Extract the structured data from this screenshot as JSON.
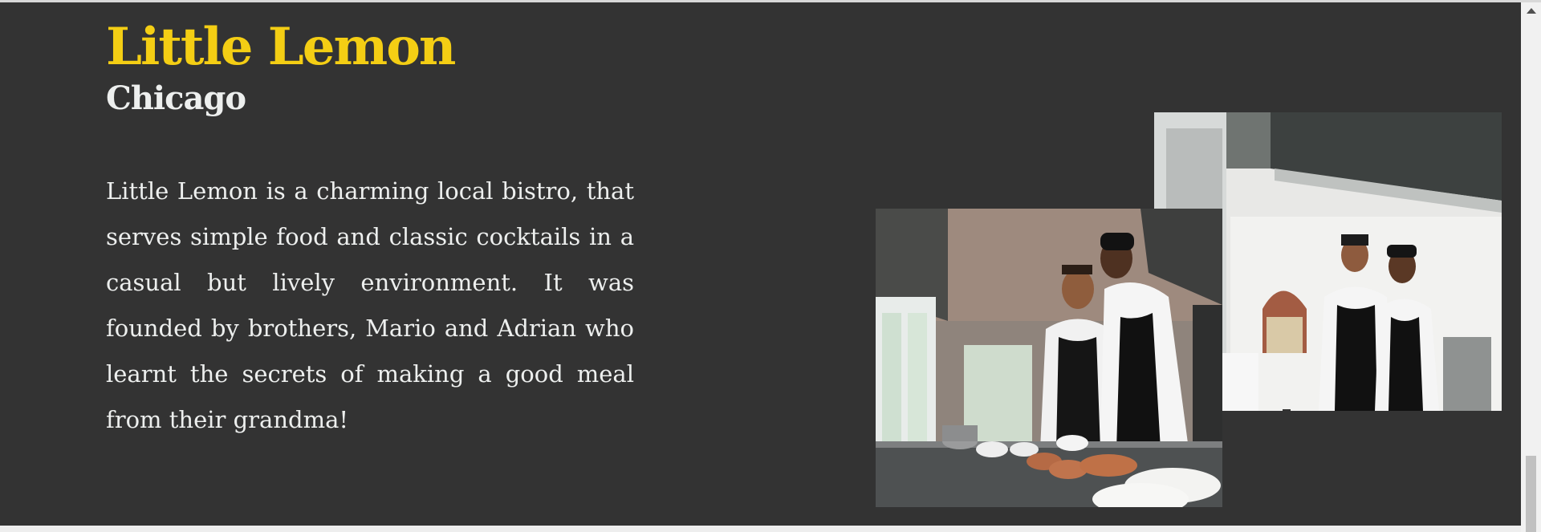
{
  "about": {
    "title": "Little Lemon",
    "subtitle": "Chicago",
    "description": "Little Lemon is a charming local bistro, that serves simple food and classic cocktails in a casual but lively environment. It was founded by brothers, Mario and Adrian who learnt the secrets of making a good meal from their grandma!"
  },
  "colors": {
    "background": "#333333",
    "title": "#F4CE14",
    "text": "#EDEFEE"
  },
  "images": {
    "back": "chefs-laughing-photo",
    "front": "chefs-cooking-photo"
  }
}
